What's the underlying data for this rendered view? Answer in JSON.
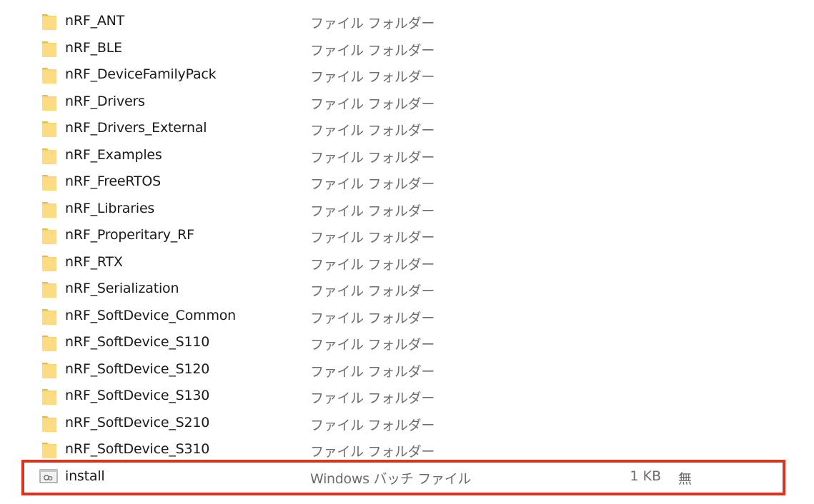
{
  "file_list": {
    "rows": [
      {
        "name": "nRF_ANT",
        "type": "ファイル フォルダー",
        "icon": "folder-icon"
      },
      {
        "name": "nRF_BLE",
        "type": "ファイル フォルダー",
        "icon": "folder-icon"
      },
      {
        "name": "nRF_DeviceFamilyPack",
        "type": "ファイル フォルダー",
        "icon": "folder-icon"
      },
      {
        "name": "nRF_Drivers",
        "type": "ファイル フォルダー",
        "icon": "folder-icon"
      },
      {
        "name": "nRF_Drivers_External",
        "type": "ファイル フォルダー",
        "icon": "folder-icon"
      },
      {
        "name": "nRF_Examples",
        "type": "ファイル フォルダー",
        "icon": "folder-icon"
      },
      {
        "name": "nRF_FreeRTOS",
        "type": "ファイル フォルダー",
        "icon": "folder-icon"
      },
      {
        "name": "nRF_Libraries",
        "type": "ファイル フォルダー",
        "icon": "folder-icon"
      },
      {
        "name": "nRF_Properitary_RF",
        "type": "ファイル フォルダー",
        "icon": "folder-icon"
      },
      {
        "name": "nRF_RTX",
        "type": "ファイル フォルダー",
        "icon": "folder-icon"
      },
      {
        "name": "nRF_Serialization",
        "type": "ファイル フォルダー",
        "icon": "folder-icon"
      },
      {
        "name": "nRF_SoftDevice_Common",
        "type": "ファイル フォルダー",
        "icon": "folder-icon"
      },
      {
        "name": "nRF_SoftDevice_S110",
        "type": "ファイル フォルダー",
        "icon": "folder-icon"
      },
      {
        "name": "nRF_SoftDevice_S120",
        "type": "ファイル フォルダー",
        "icon": "folder-icon"
      },
      {
        "name": "nRF_SoftDevice_S130",
        "type": "ファイル フォルダー",
        "icon": "folder-icon"
      },
      {
        "name": "nRF_SoftDevice_S210",
        "type": "ファイル フォルダー",
        "icon": "folder-icon"
      },
      {
        "name": "nRF_SoftDevice_S310",
        "type": "ファイル フォルダー",
        "icon": "folder-icon"
      },
      {
        "name": "install",
        "type": "Windows バッチ ファイル",
        "size": "1 KB",
        "extra": "無",
        "icon": "batch-file-icon"
      }
    ]
  },
  "colors": {
    "highlight": "#d9341e",
    "folder": "#f8d775",
    "folder_dark": "#e7b84b",
    "name_text": "#1a1a1a",
    "meta_text": "#6d6d6d"
  }
}
